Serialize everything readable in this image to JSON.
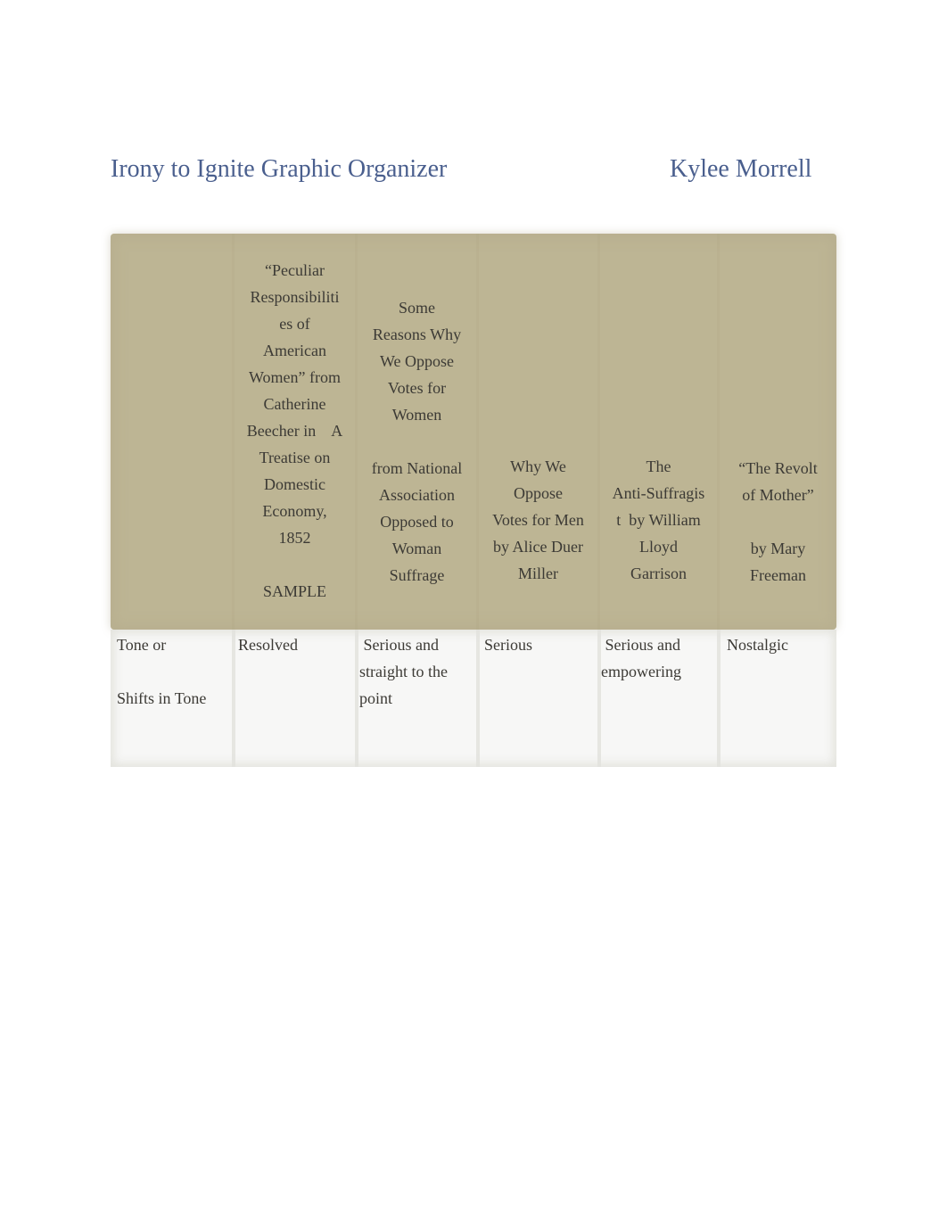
{
  "document": {
    "title": "Irony to Ignite Graphic Organizer",
    "author": "Kylee Morrell"
  },
  "table": {
    "header_colors": {
      "header_bg": "#bdb594",
      "body_bg": "#f7f7f6"
    },
    "columns": [
      {
        "lines": []
      },
      {
        "lines": [
          "“Peculiar",
          "Responsibiliti",
          "es of",
          "American",
          "Women” from",
          "Catherine",
          "Beecher in    A",
          "Treatise on",
          "Domestic",
          "Economy,",
          "1852",
          "",
          "SAMPLE"
        ]
      },
      {
        "lines": [
          "Some",
          "Reasons Why",
          "We Oppose",
          "Votes for",
          "Women",
          "",
          "from National",
          "Association",
          "Opposed to",
          "Woman",
          "Suffrage"
        ]
      },
      {
        "lines": [
          "Why We",
          "Oppose",
          "Votes for Men",
          "by Alice Duer",
          "Miller"
        ]
      },
      {
        "lines": [
          "The",
          "Anti-Suffragis",
          "t  by William",
          "Lloyd",
          "Garrison"
        ]
      },
      {
        "lines": [
          "“The Revolt",
          "of Mother”",
          "",
          "by Mary",
          "Freeman"
        ]
      }
    ],
    "rows": [
      {
        "label_line1": "Tone or",
        "label_line2": "Shifts in Tone",
        "cells": [
          {
            "lines": [
              "Resolved"
            ]
          },
          {
            "lines": [
              " Serious and",
              "straight to the",
              "point"
            ]
          },
          {
            "lines": [
              "Serious"
            ]
          },
          {
            "lines": [
              " Serious and",
              "empowering"
            ]
          },
          {
            "lines": [
              "Nostalgic"
            ]
          }
        ]
      }
    ]
  }
}
